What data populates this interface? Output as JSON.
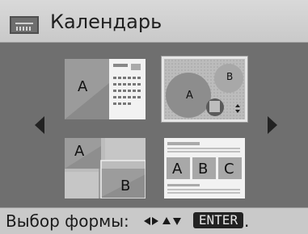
{
  "header": {
    "title": "Календарь",
    "icon": "calendar-icon"
  },
  "layouts": [
    {
      "id": "layout-1",
      "label_a": "A"
    },
    {
      "id": "layout-2",
      "label_a": "A",
      "label_b": "B"
    },
    {
      "id": "layout-3",
      "label_a": "A",
      "label_b": "B"
    },
    {
      "id": "layout-4",
      "label_a": "A",
      "label_b": "B",
      "label_c": "C"
    }
  ],
  "selected_layout": 2,
  "footer": {
    "prompt": "Выбор формы:",
    "enter_label": "ENTER",
    "end_mark": "."
  },
  "colors": {
    "header_bg": "#c9c9c9",
    "screen_bg": "#6f6f6f",
    "highlight": "#e6e6e6"
  }
}
